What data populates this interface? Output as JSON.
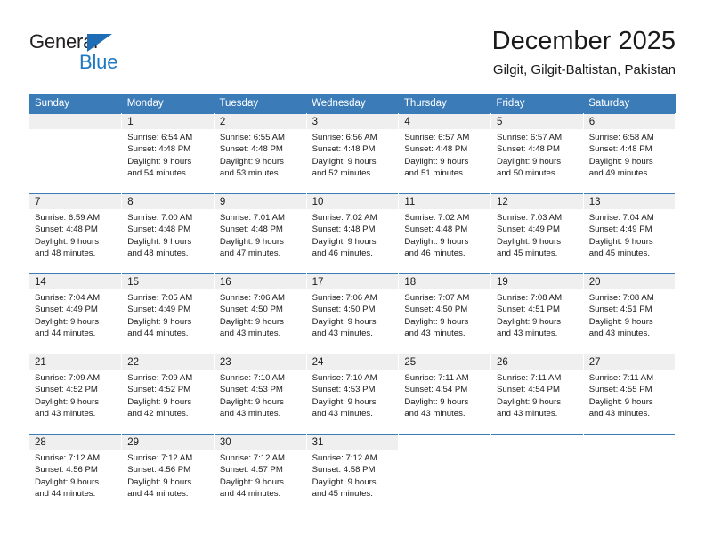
{
  "brand": {
    "name_top": "General",
    "name_bottom": "Blue",
    "triangle_icon": "triangle-icon",
    "accent_color": "#1f7ac4"
  },
  "header": {
    "title": "December 2025",
    "subtitle": "Gilgit, Gilgit-Baltistan, Pakistan"
  },
  "colors": {
    "header_row_bg": "#3b7cb8",
    "date_strip_bg": "#efefef",
    "text": "#1a1a1a",
    "page_bg": "#ffffff"
  },
  "weekdays": [
    "Sunday",
    "Monday",
    "Tuesday",
    "Wednesday",
    "Thursday",
    "Friday",
    "Saturday"
  ],
  "weeks": [
    [
      {
        "date": "",
        "sunrise": "",
        "sunset": "",
        "daylight_1": "",
        "daylight_2": "",
        "empty": true
      },
      {
        "date": "1",
        "sunrise": "Sunrise: 6:54 AM",
        "sunset": "Sunset: 4:48 PM",
        "daylight_1": "Daylight: 9 hours",
        "daylight_2": "and 54 minutes."
      },
      {
        "date": "2",
        "sunrise": "Sunrise: 6:55 AM",
        "sunset": "Sunset: 4:48 PM",
        "daylight_1": "Daylight: 9 hours",
        "daylight_2": "and 53 minutes."
      },
      {
        "date": "3",
        "sunrise": "Sunrise: 6:56 AM",
        "sunset": "Sunset: 4:48 PM",
        "daylight_1": "Daylight: 9 hours",
        "daylight_2": "and 52 minutes."
      },
      {
        "date": "4",
        "sunrise": "Sunrise: 6:57 AM",
        "sunset": "Sunset: 4:48 PM",
        "daylight_1": "Daylight: 9 hours",
        "daylight_2": "and 51 minutes."
      },
      {
        "date": "5",
        "sunrise": "Sunrise: 6:57 AM",
        "sunset": "Sunset: 4:48 PM",
        "daylight_1": "Daylight: 9 hours",
        "daylight_2": "and 50 minutes."
      },
      {
        "date": "6",
        "sunrise": "Sunrise: 6:58 AM",
        "sunset": "Sunset: 4:48 PM",
        "daylight_1": "Daylight: 9 hours",
        "daylight_2": "and 49 minutes."
      }
    ],
    [
      {
        "date": "7",
        "sunrise": "Sunrise: 6:59 AM",
        "sunset": "Sunset: 4:48 PM",
        "daylight_1": "Daylight: 9 hours",
        "daylight_2": "and 48 minutes."
      },
      {
        "date": "8",
        "sunrise": "Sunrise: 7:00 AM",
        "sunset": "Sunset: 4:48 PM",
        "daylight_1": "Daylight: 9 hours",
        "daylight_2": "and 48 minutes."
      },
      {
        "date": "9",
        "sunrise": "Sunrise: 7:01 AM",
        "sunset": "Sunset: 4:48 PM",
        "daylight_1": "Daylight: 9 hours",
        "daylight_2": "and 47 minutes."
      },
      {
        "date": "10",
        "sunrise": "Sunrise: 7:02 AM",
        "sunset": "Sunset: 4:48 PM",
        "daylight_1": "Daylight: 9 hours",
        "daylight_2": "and 46 minutes."
      },
      {
        "date": "11",
        "sunrise": "Sunrise: 7:02 AM",
        "sunset": "Sunset: 4:48 PM",
        "daylight_1": "Daylight: 9 hours",
        "daylight_2": "and 46 minutes."
      },
      {
        "date": "12",
        "sunrise": "Sunrise: 7:03 AM",
        "sunset": "Sunset: 4:49 PM",
        "daylight_1": "Daylight: 9 hours",
        "daylight_2": "and 45 minutes."
      },
      {
        "date": "13",
        "sunrise": "Sunrise: 7:04 AM",
        "sunset": "Sunset: 4:49 PM",
        "daylight_1": "Daylight: 9 hours",
        "daylight_2": "and 45 minutes."
      }
    ],
    [
      {
        "date": "14",
        "sunrise": "Sunrise: 7:04 AM",
        "sunset": "Sunset: 4:49 PM",
        "daylight_1": "Daylight: 9 hours",
        "daylight_2": "and 44 minutes."
      },
      {
        "date": "15",
        "sunrise": "Sunrise: 7:05 AM",
        "sunset": "Sunset: 4:49 PM",
        "daylight_1": "Daylight: 9 hours",
        "daylight_2": "and 44 minutes."
      },
      {
        "date": "16",
        "sunrise": "Sunrise: 7:06 AM",
        "sunset": "Sunset: 4:50 PM",
        "daylight_1": "Daylight: 9 hours",
        "daylight_2": "and 43 minutes."
      },
      {
        "date": "17",
        "sunrise": "Sunrise: 7:06 AM",
        "sunset": "Sunset: 4:50 PM",
        "daylight_1": "Daylight: 9 hours",
        "daylight_2": "and 43 minutes."
      },
      {
        "date": "18",
        "sunrise": "Sunrise: 7:07 AM",
        "sunset": "Sunset: 4:50 PM",
        "daylight_1": "Daylight: 9 hours",
        "daylight_2": "and 43 minutes."
      },
      {
        "date": "19",
        "sunrise": "Sunrise: 7:08 AM",
        "sunset": "Sunset: 4:51 PM",
        "daylight_1": "Daylight: 9 hours",
        "daylight_2": "and 43 minutes."
      },
      {
        "date": "20",
        "sunrise": "Sunrise: 7:08 AM",
        "sunset": "Sunset: 4:51 PM",
        "daylight_1": "Daylight: 9 hours",
        "daylight_2": "and 43 minutes."
      }
    ],
    [
      {
        "date": "21",
        "sunrise": "Sunrise: 7:09 AM",
        "sunset": "Sunset: 4:52 PM",
        "daylight_1": "Daylight: 9 hours",
        "daylight_2": "and 43 minutes."
      },
      {
        "date": "22",
        "sunrise": "Sunrise: 7:09 AM",
        "sunset": "Sunset: 4:52 PM",
        "daylight_1": "Daylight: 9 hours",
        "daylight_2": "and 42 minutes."
      },
      {
        "date": "23",
        "sunrise": "Sunrise: 7:10 AM",
        "sunset": "Sunset: 4:53 PM",
        "daylight_1": "Daylight: 9 hours",
        "daylight_2": "and 43 minutes."
      },
      {
        "date": "24",
        "sunrise": "Sunrise: 7:10 AM",
        "sunset": "Sunset: 4:53 PM",
        "daylight_1": "Daylight: 9 hours",
        "daylight_2": "and 43 minutes."
      },
      {
        "date": "25",
        "sunrise": "Sunrise: 7:11 AM",
        "sunset": "Sunset: 4:54 PM",
        "daylight_1": "Daylight: 9 hours",
        "daylight_2": "and 43 minutes."
      },
      {
        "date": "26",
        "sunrise": "Sunrise: 7:11 AM",
        "sunset": "Sunset: 4:54 PM",
        "daylight_1": "Daylight: 9 hours",
        "daylight_2": "and 43 minutes."
      },
      {
        "date": "27",
        "sunrise": "Sunrise: 7:11 AM",
        "sunset": "Sunset: 4:55 PM",
        "daylight_1": "Daylight: 9 hours",
        "daylight_2": "and 43 minutes."
      }
    ],
    [
      {
        "date": "28",
        "sunrise": "Sunrise: 7:12 AM",
        "sunset": "Sunset: 4:56 PM",
        "daylight_1": "Daylight: 9 hours",
        "daylight_2": "and 44 minutes."
      },
      {
        "date": "29",
        "sunrise": "Sunrise: 7:12 AM",
        "sunset": "Sunset: 4:56 PM",
        "daylight_1": "Daylight: 9 hours",
        "daylight_2": "and 44 minutes."
      },
      {
        "date": "30",
        "sunrise": "Sunrise: 7:12 AM",
        "sunset": "Sunset: 4:57 PM",
        "daylight_1": "Daylight: 9 hours",
        "daylight_2": "and 44 minutes."
      },
      {
        "date": "31",
        "sunrise": "Sunrise: 7:12 AM",
        "sunset": "Sunset: 4:58 PM",
        "daylight_1": "Daylight: 9 hours",
        "daylight_2": "and 45 minutes."
      },
      {
        "date": "",
        "sunrise": "",
        "sunset": "",
        "daylight_1": "",
        "daylight_2": "",
        "blank": true
      },
      {
        "date": "",
        "sunrise": "",
        "sunset": "",
        "daylight_1": "",
        "daylight_2": "",
        "blank": true
      },
      {
        "date": "",
        "sunrise": "",
        "sunset": "",
        "daylight_1": "",
        "daylight_2": "",
        "blank": true
      }
    ]
  ]
}
